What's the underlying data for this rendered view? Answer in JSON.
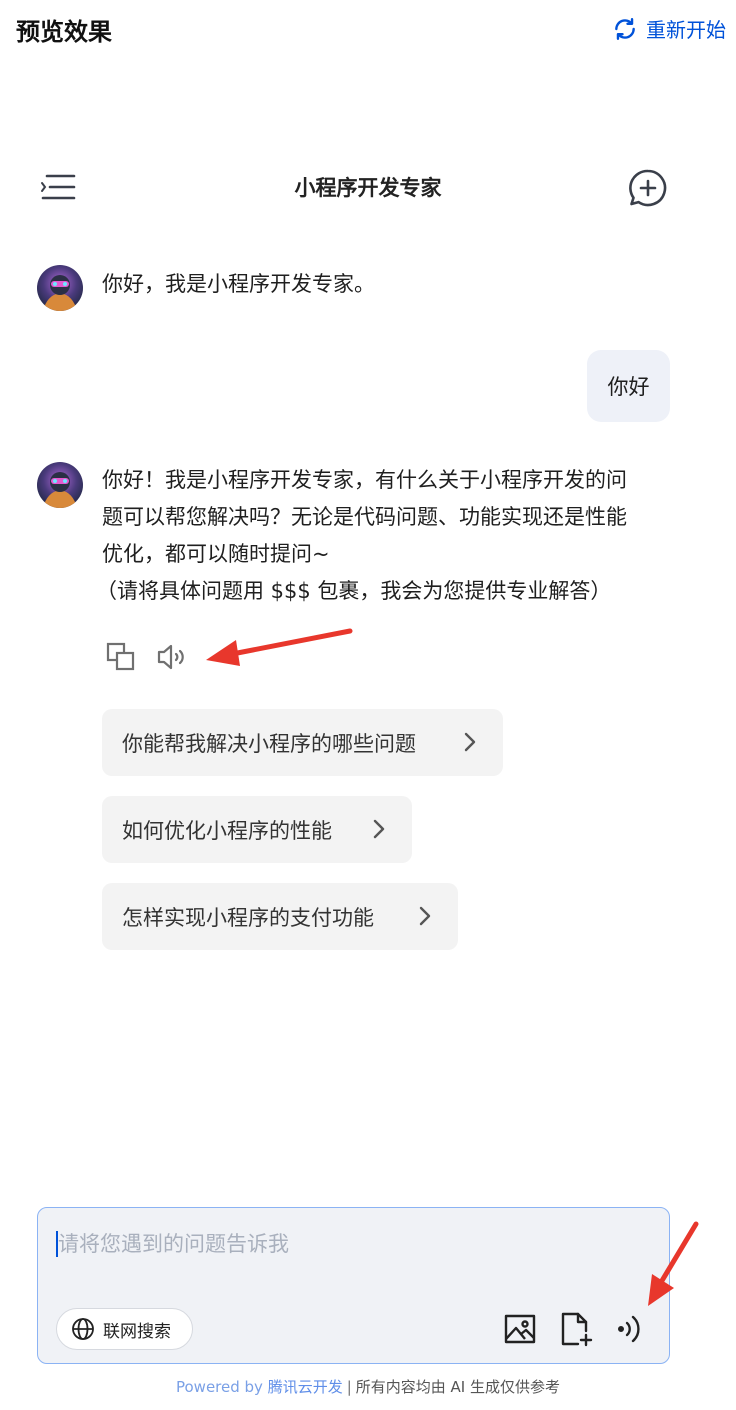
{
  "header": {
    "title": "预览效果",
    "restart_label": "重新开始",
    "accent_color": "#0052d9"
  },
  "chat": {
    "title": "小程序开发专家",
    "greeting": "你好，我是小程序开发专家。",
    "user_message": "你好",
    "reply_lines": [
      "你好！我是小程序开发专家，有什么关于小程序开发的问",
      "题可以帮您解决吗？无论是代码问题、功能实现还是性能",
      "优化，都可以随时提问~",
      "（请将具体问题用 $$$ 包裹，我会为您提供专业解答）"
    ],
    "actions": [
      "copy-icon",
      "speaker-icon"
    ],
    "suggestions": [
      "你能帮我解决小程序的哪些问题",
      "如何优化小程序的性能",
      "怎样实现小程序的支付功能"
    ]
  },
  "input": {
    "placeholder": "请将您遇到的问题告诉我",
    "value": "",
    "web_search_label": "联网搜索",
    "tools": [
      "image-icon",
      "file-add-icon",
      "voice-icon"
    ]
  },
  "footer": {
    "powered_prefix": "Powered by ",
    "brand": "腾讯云开发",
    "separator": "|",
    "disclaimer": "所有内容均由 AI 生成仅供参考"
  },
  "annotation_color": "#e8372c"
}
